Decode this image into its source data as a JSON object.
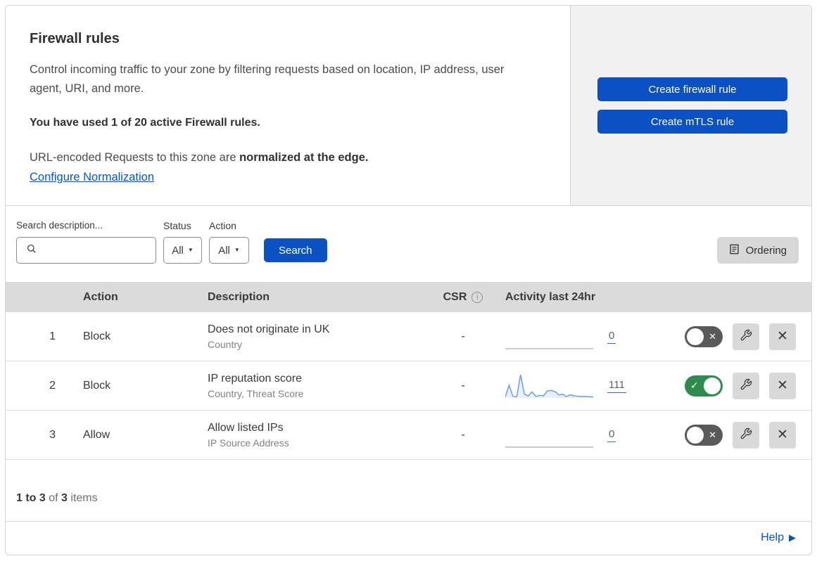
{
  "header": {
    "title": "Firewall rules",
    "description": "Control incoming traffic to your zone by filtering requests based on location, IP address, user agent, URI, and more.",
    "usage_text": "You have used 1 of 20 active Firewall rules.",
    "normalization_prefix": "URL-encoded Requests to this zone are ",
    "normalization_bold": "normalized at the edge.",
    "normalization_link": "Configure Normalization",
    "buttons": {
      "create_firewall": "Create firewall rule",
      "create_mtls": "Create mTLS rule"
    }
  },
  "filters": {
    "search_label": "Search description...",
    "status_label": "Status",
    "status_value": "All",
    "action_label": "Action",
    "action_value": "All",
    "search_button": "Search",
    "ordering_button": "Ordering"
  },
  "table": {
    "headers": {
      "action": "Action",
      "description": "Description",
      "csr": "CSR",
      "activity": "Activity last 24hr"
    },
    "rows": [
      {
        "index": "1",
        "action": "Block",
        "description": "Does not originate in UK",
        "criteria": "Country",
        "csr": "-",
        "activity_count": "0",
        "enabled": false,
        "sparkline": [
          0,
          0
        ]
      },
      {
        "index": "2",
        "action": "Block",
        "description": "IP reputation score",
        "criteria": "Country, Threat Score",
        "csr": "-",
        "activity_count": "111",
        "enabled": true,
        "sparkline": [
          4,
          55,
          7,
          5,
          100,
          16,
          8,
          26,
          6,
          11,
          9,
          30,
          32,
          27,
          13,
          16,
          6,
          13,
          9,
          7,
          6,
          6,
          5,
          5
        ]
      },
      {
        "index": "3",
        "action": "Allow",
        "description": "Allow listed IPs",
        "criteria": "IP Source Address",
        "csr": "-",
        "activity_count": "0",
        "enabled": false,
        "sparkline": [
          0,
          0
        ]
      }
    ]
  },
  "footer": {
    "range": "1 to 3",
    "of_label": "of",
    "total": "3",
    "items_label": "items"
  },
  "help": {
    "label": "Help"
  },
  "icons": {
    "close": "✕",
    "check": "✓",
    "caret": "▼",
    "help_arrow": "▶",
    "info": "i",
    "toggle_x": "✕"
  },
  "colors": {
    "primary_blue": "#0b51c4",
    "link_blue": "#0055dc",
    "toggle_on_green": "#2e8b50",
    "toggle_off_gray": "#595959",
    "sparkline_blue": "#6d9eea",
    "table_header_bg": "#dbdbdb",
    "panel_bg": "#f1f1f1"
  }
}
